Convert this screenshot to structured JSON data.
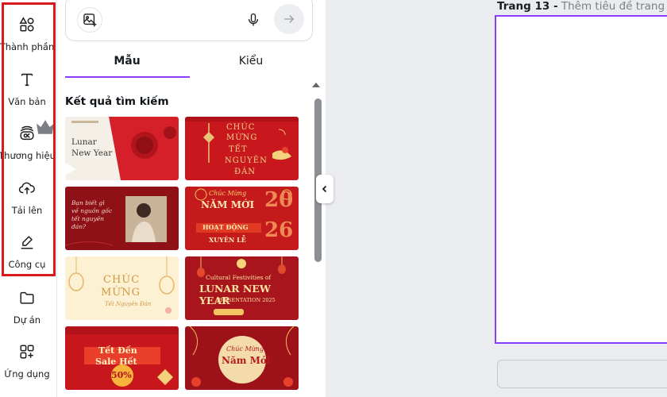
{
  "rail": {
    "items": [
      {
        "label": "Thành phần",
        "icon": "elements-icon"
      },
      {
        "label": "Văn bản",
        "icon": "text-icon"
      },
      {
        "label": "Thương hiệu",
        "icon": "brand-icon"
      },
      {
        "label": "Tải lên",
        "icon": "upload-icon"
      },
      {
        "label": "Công cụ",
        "icon": "tools-icon"
      },
      {
        "label": "Dự án",
        "icon": "folder-icon"
      },
      {
        "label": "Ứng dụng",
        "icon": "apps-icon"
      }
    ],
    "highlight_color": "#d91a1a"
  },
  "panel": {
    "tabs": [
      {
        "label": "Mẫu",
        "active": true
      },
      {
        "label": "Kiểu",
        "active": false
      }
    ],
    "results_heading": "Kết quả tìm kiếm"
  },
  "templates": [
    {
      "lines": [
        "Lunar",
        "New Year"
      ]
    },
    {
      "lines": [
        "CHÚC",
        "MỪNG",
        "TẾT",
        "NGUYÊN",
        "ĐÁN"
      ]
    },
    {
      "lines": [
        "Bạn biết gì",
        "về nguồn gốc",
        "tết nguyên",
        "đán?"
      ]
    },
    {
      "lines": [
        "Chúc Mừng",
        "NĂM MỚI",
        "HOẠT ĐỘNG",
        "XUYÊN LỄ",
        "20",
        "26"
      ]
    },
    {
      "lines": [
        "CHÚC",
        "MỪNG",
        "Tết Nguyên Đán"
      ]
    },
    {
      "lines": [
        "Cultural Festivities of",
        "LUNAR NEW YEAR",
        "PRESENTATION 2025"
      ]
    },
    {
      "lines": [
        "Tết Đến",
        "Sale Hết",
        "50%"
      ]
    },
    {
      "lines": [
        "Chúc Mừng",
        "Năm Mới"
      ]
    }
  ],
  "canvas": {
    "page_label": "Trang 13 -",
    "title_placeholder": "Thêm tiêu đề trang",
    "accent": "#8b3dff"
  }
}
